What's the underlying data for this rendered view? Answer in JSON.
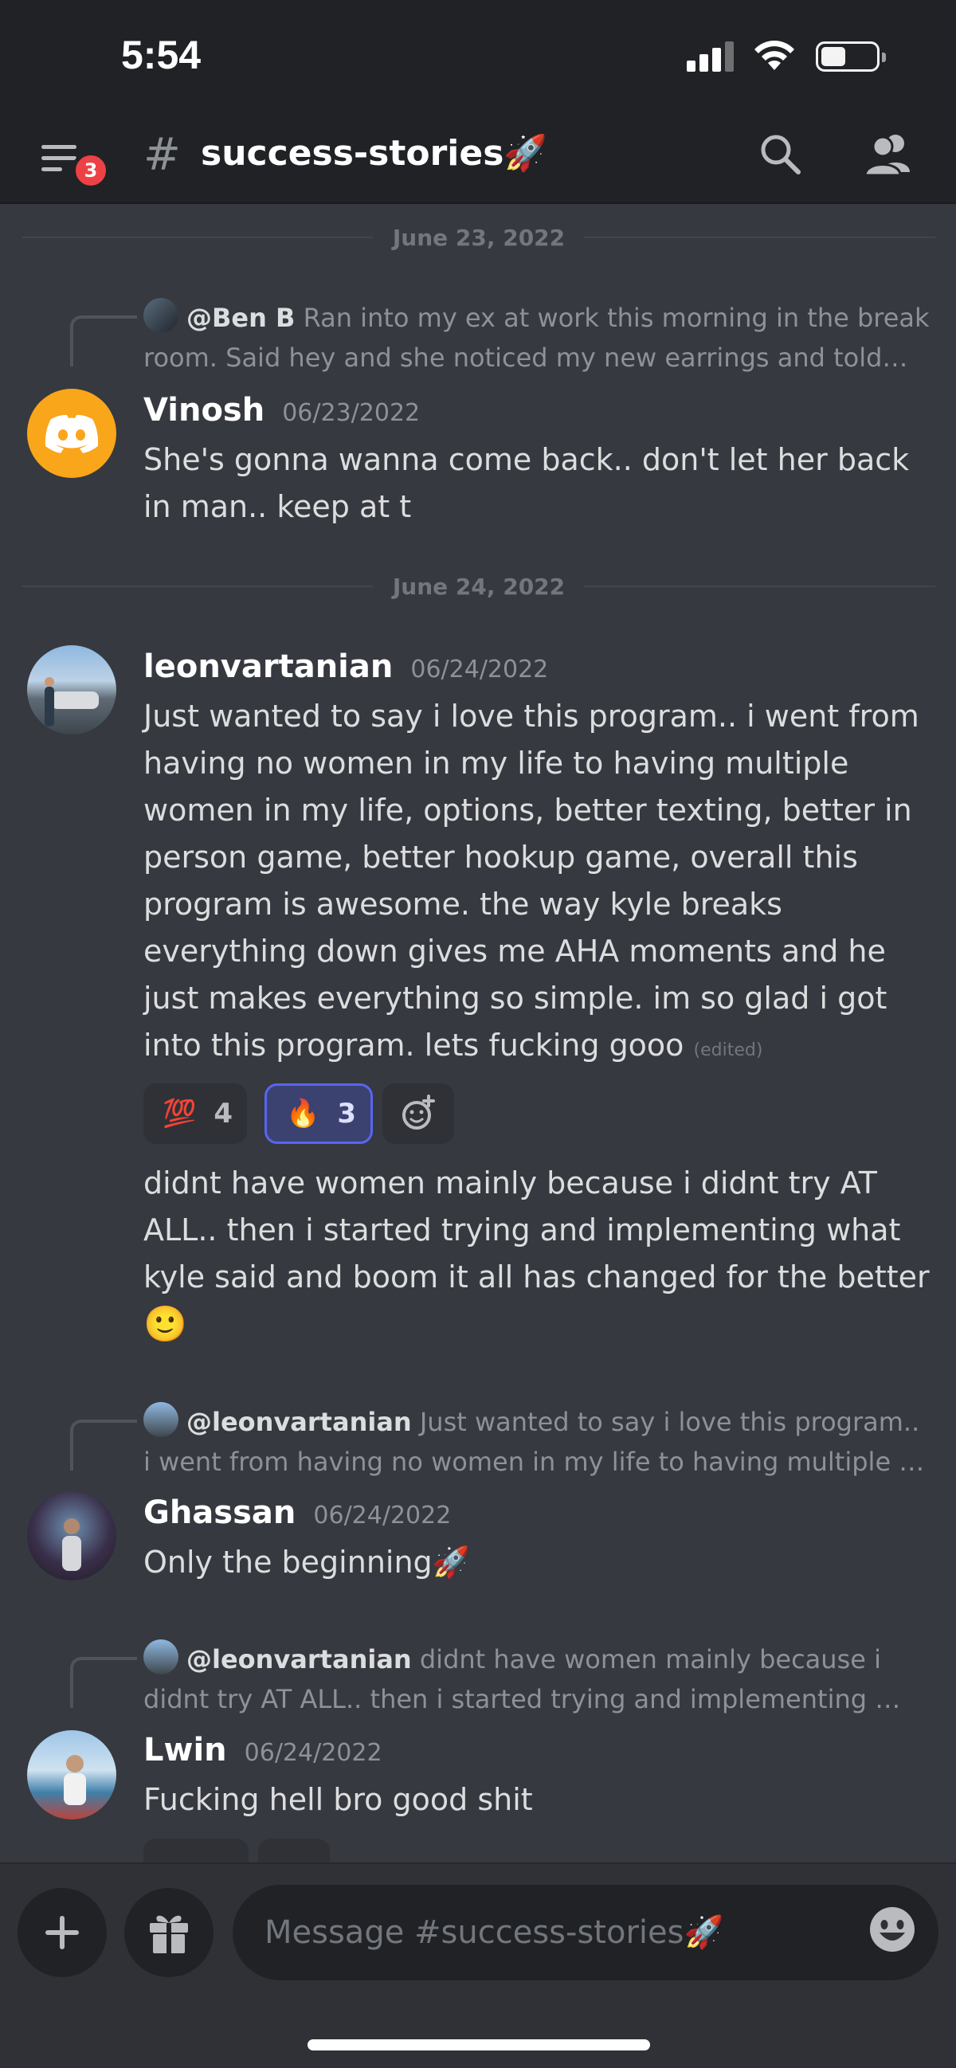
{
  "status_bar": {
    "time": "5:54"
  },
  "header": {
    "menu_badge": "3",
    "hash": "#",
    "channel_name": "success-stories🚀"
  },
  "dividers": [
    "June 23, 2022",
    "June 24, 2022"
  ],
  "messages": [
    {
      "reply": {
        "author": "@Ben B",
        "text": "Ran into my ex at work this morning in the break room. Said hey and she noticed my new earrings and told…"
      },
      "author": "Vinosh",
      "timestamp": "06/23/2022",
      "text": "She's gonna wanna come back.. don't let her back in man.. keep at t"
    },
    {
      "author": "leonvartanian",
      "timestamp": "06/24/2022",
      "text": "Just wanted to say i love this program.. i went from having no women in my life to having multiple women in my life, options, better texting, better in person game, better hookup game, overall this program is awesome. the way kyle breaks everything down gives me AHA moments and he just makes everything so simple. im so glad i got into this program. lets fucking gooo",
      "edited": "(edited)",
      "reactions": [
        {
          "emoji": "💯",
          "count": "4",
          "active": false
        },
        {
          "emoji": "🔥",
          "count": "3",
          "active": true
        }
      ],
      "followup": "didnt have women mainly because i didnt try AT ALL.. then i started trying and implementing what kyle said and boom it all has changed for the better",
      "followup_emoji": "🙂"
    },
    {
      "reply": {
        "author": "@leonvartanian",
        "text": "Just wanted to say i love this program.. i went from having no women in my life to having multiple …"
      },
      "author": "Ghassan",
      "timestamp": "06/24/2022",
      "text": "Only the beginning🚀"
    },
    {
      "reply": {
        "author": "@leonvartanian",
        "text": "didnt have women mainly because i didnt try AT ALL.. then i started trying and implementing …"
      },
      "author": "Lwin",
      "timestamp": "06/24/2022",
      "text": "Fucking hell bro good shit"
    }
  ],
  "composer": {
    "placeholder": "Message #success-stories🚀"
  },
  "colors": {
    "background": "#36393f",
    "header": "#202225",
    "accent": "#5865f2",
    "badge": "#ed4245",
    "discord_yellow": "#faa61a"
  }
}
